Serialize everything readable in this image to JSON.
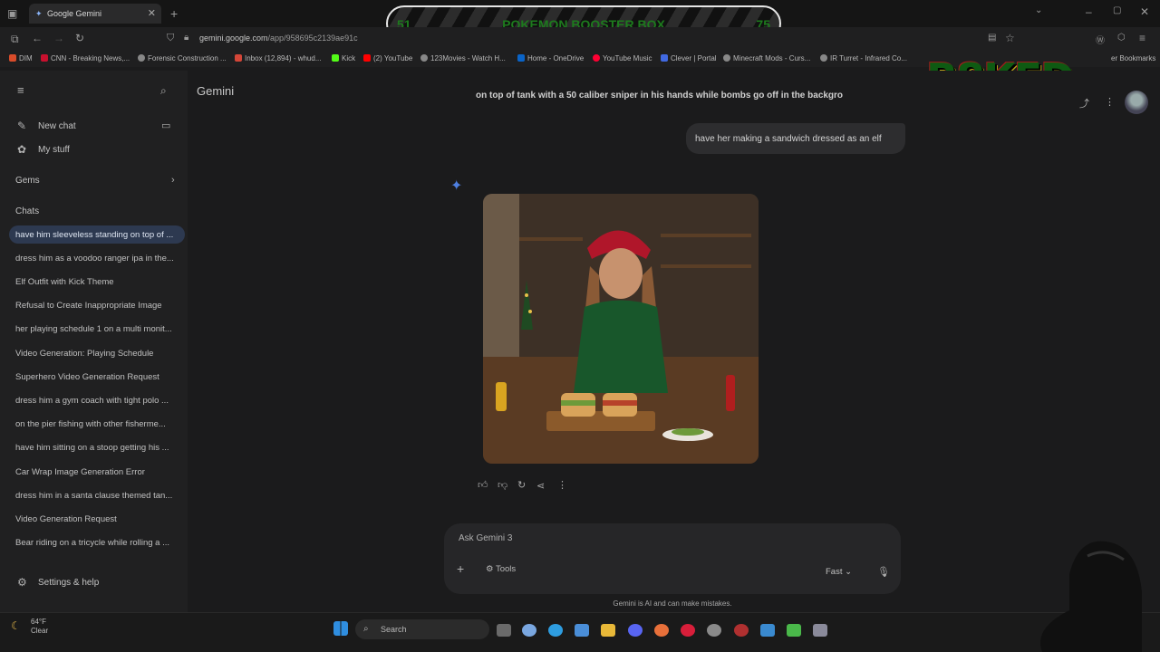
{
  "browser": {
    "tab_title": "Google Gemini",
    "tab_close": "✕",
    "new_tab": "+",
    "url_host": "gemini.google.com",
    "url_path": "/app/958695c2139ae91c",
    "bookmarks": [
      "DIM",
      "CNN - Breaking News,...",
      "Forensic Construction ...",
      "Inbox (12,894) - whud...",
      "Kick",
      "(2) YouTube",
      "123Movies - Watch H...",
      "Home - OneDrive",
      "YouTube Music",
      "Clever | Portal",
      "Minecraft Mods - Curs...",
      "IR Turret - Infrared Co..."
    ],
    "bookmarks_right": "er Bookmarks"
  },
  "stream_overlay": {
    "left_count": "51",
    "title": "POKEMON BOOSTER BOX",
    "right_count": "75",
    "logo": "B8KED"
  },
  "sidebar": {
    "new_chat": "New chat",
    "my_stuff": "My stuff",
    "gems": "Gems",
    "chats_header": "Chats",
    "chats": [
      "have him sleeveless standing on top of ...",
      "dress him as a voodoo ranger ipa in the...",
      "Elf Outfit with Kick Theme",
      "Refusal to Create Inappropriate Image",
      "her playing schedule 1 on a multi monit...",
      "Video Generation: Playing Schedule",
      "Superhero Video Generation Request",
      "dress him a gym coach with tight polo ...",
      "on the pier fishing with other fisherme...",
      "have him sitting on a stoop getting his ...",
      "Car Wrap Image Generation Error",
      "dress him in a santa clause themed tan...",
      "Video Generation Request",
      "Bear riding on a tricycle while rolling a ..."
    ],
    "settings": "Settings & help"
  },
  "main": {
    "brand": "Gemini",
    "previous_prompt": "on top of tank with a 50 caliber sniper in his hands while bombs go off in the backgro",
    "user_message": "have her making a sandwich dressed as an elf",
    "composer_placeholder": "Ask Gemini 3",
    "tools_label": "Tools",
    "mode_label": "Fast",
    "disclaimer": "Gemini is AI and can make mistakes."
  },
  "taskbar": {
    "temperature": "64°F",
    "condition": "Clear",
    "search": "Search"
  },
  "colors": {
    "accent": "#4e7fe0",
    "active_chat": "#2d3950",
    "overlay_text": "#1d7a1d"
  }
}
